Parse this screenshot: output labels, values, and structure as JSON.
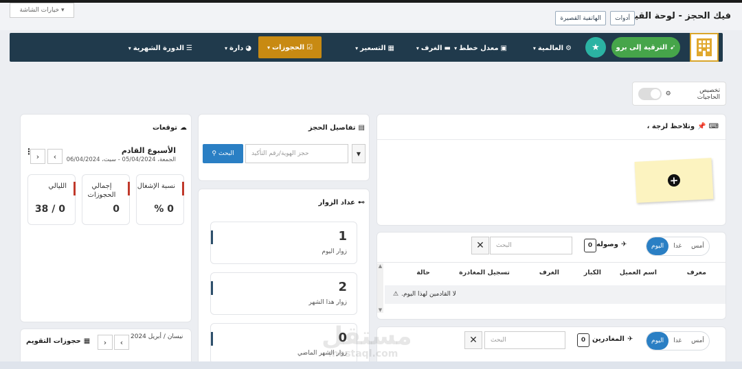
{
  "header": {
    "screen_options": "خيارات الشاشة",
    "title": "فيك الحجز - لوحة القيادة",
    "tools_btn": "أدوات",
    "mobile_btn": "الهاتفية القصيرة"
  },
  "nav": {
    "upgrade": "الترقية إلى برو",
    "items": [
      {
        "label": "العالمية"
      },
      {
        "label": "معدل خطط"
      },
      {
        "label": "الغرف"
      },
      {
        "label": "التسعير"
      },
      {
        "label": "الحجوزات"
      },
      {
        "label": "دارة"
      },
      {
        "label": "الدورة الشهرية"
      }
    ]
  },
  "toggle": {
    "label": "تخصيص الحاجيات"
  },
  "notes": {
    "title": "وتلاحظ لزجة ،"
  },
  "arrivals": {
    "title": "وصوله",
    "count": "0",
    "seg": [
      "اليوم",
      "غدا",
      "أمس"
    ],
    "search_placeholder": "البحث",
    "columns": [
      "معرف",
      "اسم العميل",
      "الكبار",
      "الغرف",
      "تسجيل المغادرة",
      "حالة"
    ],
    "empty": "لا القادمين لهذا اليوم."
  },
  "departures": {
    "title": "المغادرين",
    "count": "0",
    "seg": [
      "اليوم",
      "غدا",
      "أمس"
    ],
    "search_placeholder": "البحث"
  },
  "booking": {
    "title": "تفاصيل الحجز",
    "placeholder": "حجز الهوية/رقم التأكيد",
    "search_btn": "البحث"
  },
  "visitors": {
    "title": "عداد الزوار",
    "items": [
      {
        "value": "1",
        "label": "زوار اليوم"
      },
      {
        "value": "2",
        "label": "زوار هذا الشهر"
      },
      {
        "value": "0",
        "label": "زوار الشهر الماضي"
      }
    ]
  },
  "forecast": {
    "title": "توقعات",
    "week_title": "الأسبوع القادم",
    "range": "الجمعة، 05/04/2024 - سبت، 06/04/2024",
    "stats": [
      {
        "label": "نسبة الإشغال",
        "value": "0 %"
      },
      {
        "label": "إجمالي الحجوزات",
        "value": "0"
      },
      {
        "label": "الليالي",
        "value": "0 / 38"
      }
    ]
  },
  "calendar": {
    "title": "حجوزات التقويم",
    "month": "نيسان / أبريل 2024"
  },
  "watermark": {
    "text": "مستقل",
    "sub": "mostaql.com"
  },
  "colors": {
    "nav_bg": "#203a4c",
    "active": "#c88a12",
    "upgrade": "#46a54a",
    "primary": "#2a7fc4"
  }
}
